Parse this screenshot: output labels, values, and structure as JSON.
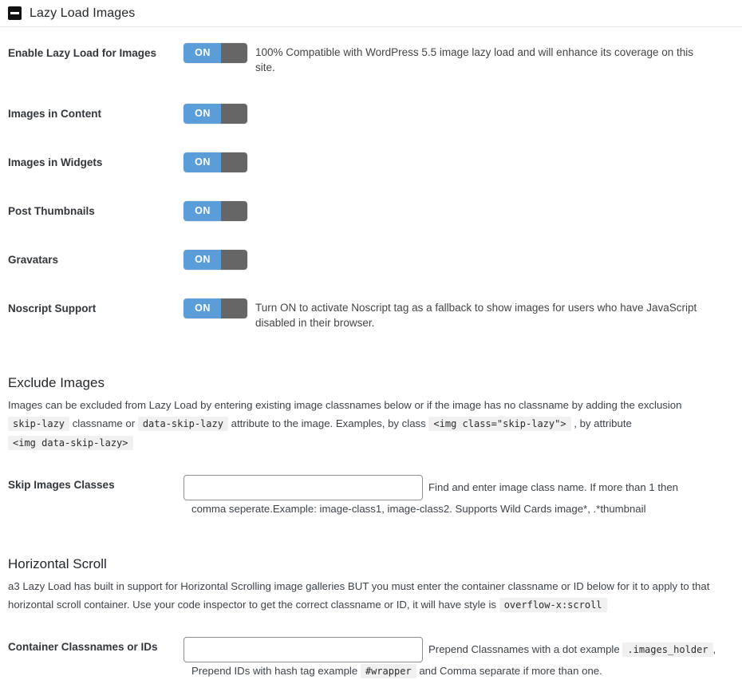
{
  "panel": {
    "title": "Lazy Load Images",
    "collapse_icon": "minus-square-icon"
  },
  "toggle_rows": [
    {
      "label": "Enable Lazy Load for Images",
      "state": "ON",
      "description": "100% Compatible with WordPress 5.5 image lazy load and will enhance its coverage on this site."
    },
    {
      "label": "Images in Content",
      "state": "ON",
      "description": ""
    },
    {
      "label": "Images in Widgets",
      "state": "ON",
      "description": ""
    },
    {
      "label": "Post Thumbnails",
      "state": "ON",
      "description": ""
    },
    {
      "label": "Gravatars",
      "state": "ON",
      "description": ""
    },
    {
      "label": "Noscript Support",
      "state": "ON",
      "description": "Turn ON to activate Noscript tag as a fallback to show images for users who have JavaScript disabled in their browser."
    }
  ],
  "exclude_images": {
    "heading": "Exclude Images",
    "paragraph": {
      "part1": "Images can be excluded from Lazy Load by entering existing image classnames below or if the image has no classname by adding the exclusion",
      "code1": "skip-lazy",
      "part2": "classname or",
      "code2": "data-skip-lazy",
      "part3": "attribute to the image. Examples, by class",
      "code3": "<img class=\"skip-lazy\">",
      "part4": ", by attribute",
      "code4": "<img data-skip-lazy>"
    },
    "field": {
      "label": "Skip Images Classes",
      "value": "",
      "placeholder": "",
      "help_right": "Find and enter image class name. If more than 1 then",
      "help_below": "comma seperate.Example: image-class1, image-class2. Supports Wild Cards image*, .*thumbnail"
    }
  },
  "horizontal_scroll": {
    "heading": "Horizontal Scroll",
    "paragraph": {
      "part1": "a3 Lazy Load has built in support for Horizontal Scrolling image galleries BUT you must enter the container classname or ID below for it to apply to that horizontal scroll container. Use your code inspector to get the correct classname or ID, it will have style is",
      "code1": "overflow-x:scroll"
    },
    "field": {
      "label": "Container Classnames or IDs",
      "value": "",
      "placeholder": "",
      "help_right_pre": "Prepend Classnames with a dot example",
      "help_right_code": ".images_holder",
      "help_right_post": ",",
      "help_below_pre": "Prepend IDs with hash tag example",
      "help_below_code": "#wrapper",
      "help_below_post": "and Comma separate if more than one."
    }
  },
  "colors": {
    "switch_on": "#5b9dd9",
    "switch_knob": "#666666",
    "text": "#32373c",
    "code_bg": "#f0f0f1"
  }
}
